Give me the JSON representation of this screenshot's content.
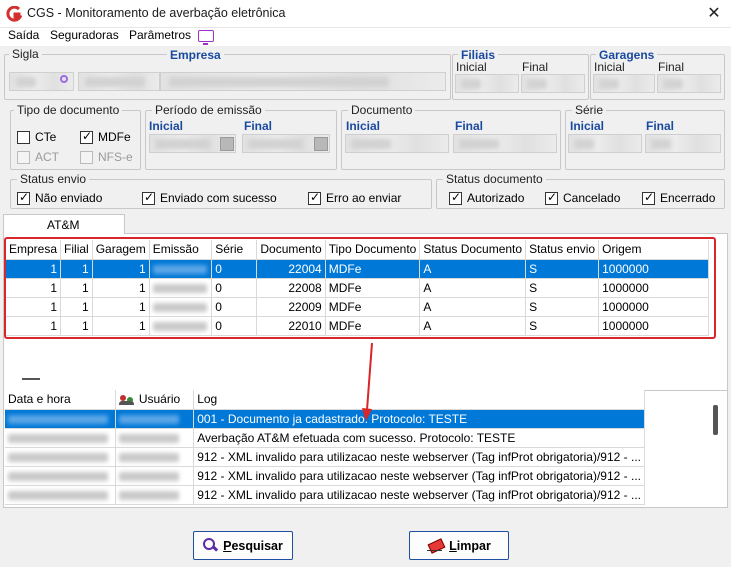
{
  "window": {
    "title": "CGS - Monitoramento de averbação eletrônica",
    "close_glyph": "✕"
  },
  "menu": [
    "Saída",
    "Seguradoras",
    "Parâmetros"
  ],
  "filters": {
    "sigla_label": "Sigla",
    "empresa_label": "Empresa",
    "filiais_label": "Filiais",
    "garagens_label": "Garagens",
    "inicial": "Inicial",
    "final": "Final",
    "tipo_documento_label": "Tipo de documento",
    "periodo_label": "Período de emissão",
    "documento_label": "Documento",
    "serie_label": "Série",
    "doc_types": [
      {
        "label": "CTe",
        "checked": false,
        "disabled": false
      },
      {
        "label": "MDFe",
        "checked": true,
        "disabled": false
      },
      {
        "label": "ACT",
        "checked": false,
        "disabled": true
      },
      {
        "label": "NFS-e",
        "checked": false,
        "disabled": true
      }
    ],
    "status_envio_label": "Status envio",
    "status_envio": [
      {
        "label": "Não enviado",
        "checked": true
      },
      {
        "label": "Enviado com sucesso",
        "checked": true
      },
      {
        "label": "Erro ao enviar",
        "checked": true
      }
    ],
    "status_documento_label": "Status documento",
    "status_documento": [
      {
        "label": "Autorizado",
        "checked": true
      },
      {
        "label": "Cancelado",
        "checked": true
      },
      {
        "label": "Encerrado",
        "checked": true
      }
    ]
  },
  "tab": {
    "label": "AT&M"
  },
  "grid": {
    "columns": [
      "Empresa",
      "Filial",
      "Garagem",
      "Emissão",
      "Série",
      "Documento",
      "Tipo Documento",
      "Status Documento",
      "Status envio",
      "Origem"
    ],
    "rows": [
      [
        "1",
        "1",
        "1",
        "",
        "0",
        "22004",
        "MDFe",
        "A",
        "S",
        "1000000"
      ],
      [
        "1",
        "1",
        "1",
        "",
        "0",
        "22008",
        "MDFe",
        "A",
        "S",
        "1000000"
      ],
      [
        "1",
        "1",
        "1",
        "",
        "0",
        "22009",
        "MDFe",
        "A",
        "S",
        "1000000"
      ],
      [
        "1",
        "1",
        "1",
        "",
        "0",
        "22010",
        "MDFe",
        "A",
        "S",
        "1000000"
      ]
    ],
    "selected_row": 0
  },
  "log": {
    "columns": [
      "Data e hora",
      "Usuário",
      "Log"
    ],
    "rows": [
      "001 - Documento ja cadastrado. Protocolo: TESTE",
      "Averbação AT&M efetuada com sucesso. Protocolo: TESTE",
      "912 - XML invalido para utilizacao neste webserver (Tag infProt obrigatoria)/912 - ...",
      "912 - XML invalido para utilizacao neste webserver (Tag infProt obrigatoria)/912 - ...",
      "912 - XML invalido para utilizacao neste webserver (Tag infProt obrigatoria)/912 - ..."
    ],
    "selected_row": 0
  },
  "buttons": {
    "search": {
      "first": "P",
      "rest": "esquisar"
    },
    "clear": {
      "first": "L",
      "rest": "impar"
    }
  },
  "colors": {
    "selection": "#0078d7",
    "highlight_box": "#d8262b",
    "label_blue": "#1a4aa0"
  }
}
